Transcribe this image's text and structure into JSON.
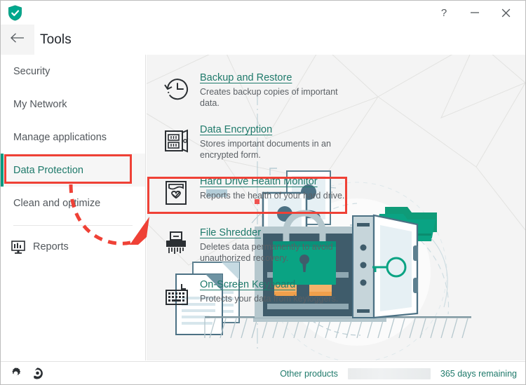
{
  "window": {
    "logo_icon": "green-shield-check-icon",
    "buttons": [
      {
        "name": "help-button",
        "icon": "question-mark-icon",
        "label": "?"
      },
      {
        "name": "minimize-button",
        "icon": "minus-icon",
        "label": "—"
      },
      {
        "name": "close-button",
        "icon": "close-x-icon",
        "label": "✕"
      }
    ]
  },
  "header": {
    "back_icon": "arrow-left-icon",
    "title": "Tools"
  },
  "sidebar": {
    "items": [
      {
        "label": "Security",
        "selected": false
      },
      {
        "label": "My Network",
        "selected": false
      },
      {
        "label": "Manage applications",
        "selected": false
      },
      {
        "label": "Data Protection",
        "selected": true
      },
      {
        "label": "Clean and optimize",
        "selected": false
      }
    ],
    "reports": {
      "label": "Reports",
      "icon": "monitor-chart-icon"
    },
    "selected_accent_color": "#009a80",
    "highlight_color": "#ef4136"
  },
  "tools": [
    {
      "icon": "clock-restore-icon",
      "title": "Backup and Restore",
      "description": "Creates backup copies of important data.",
      "highlighted": false
    },
    {
      "icon": "safe-vault-icon",
      "title": "Data Encryption",
      "description": "Stores important documents in an encrypted form.",
      "highlighted": false
    },
    {
      "icon": "hard-drive-heart-icon",
      "title": "Hard Drive Health Monitor",
      "description": "Reports the health of your hard drive.",
      "highlighted": true
    },
    {
      "icon": "paper-shredder-icon",
      "title": "File Shredder",
      "description": "Deletes data permanently to avoid unauthorized recovery.",
      "highlighted": false
    },
    {
      "icon": "keyboard-icon",
      "title": "On-Screen Keyboard",
      "description": "Protects your data from keyloggers.",
      "highlighted": false
    }
  ],
  "footer": {
    "settings_icon": "gear-icon",
    "support_icon": "support-bubble-icon",
    "other_products": "Other products",
    "license_status": "365 days remaining"
  },
  "colors": {
    "accent_teal": "#1f7a6b",
    "brand_green": "#009a80",
    "highlight_red": "#ef4136",
    "content_bg": "#f4f4f4"
  }
}
